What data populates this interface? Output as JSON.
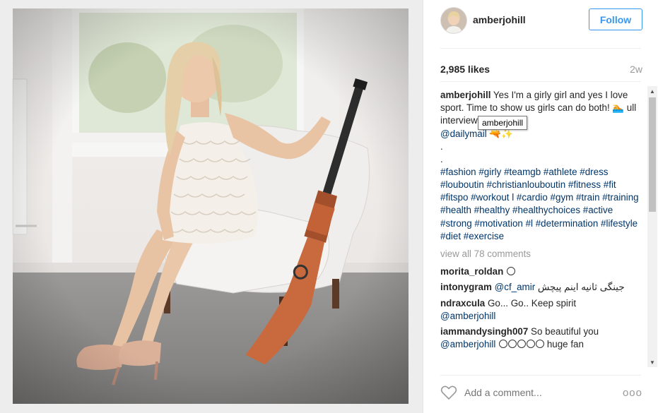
{
  "post": {
    "username": "amberjohill",
    "follow_label": "Follow",
    "likes": "2,985 likes",
    "time": "2w",
    "caption": {
      "username": "amberjohill",
      "line1": "Yes I'm a girly girl and yes I love sport. Time to show us girls can do both! 🏊",
      "line2": "ull interview in today's",
      "mention": "@dailymail",
      "dots": [
        ".",
        "."
      ],
      "hashtags": "#fashion #girly #teamgb #athlete #dress #louboutin #christianlouboutin #fitness #fit #fitspo #workout l #cardio #gym #train #training #health #healthy #healthychoices #active #strong #motivation #l #determination #lifestyle #diet #exercise"
    },
    "tooltip": "amberjohill",
    "view_all": "view all 78 comments",
    "comments": [
      {
        "user": "morita_roldan",
        "text": "",
        "emoji_count": 1
      },
      {
        "user": "intonygram",
        "mention": "@cf_amir",
        "text": "جینگی ثانیه اینم پیچش",
        "emoji_count": 0
      },
      {
        "user": "ndraxcula",
        "text": "Go... Go.. Keep spirit",
        "mention2": "@amberjohill",
        "emoji_count": 0
      },
      {
        "user": "iammandysingh007",
        "text": "So beautiful you",
        "mention2": "@amberjohill",
        "tail": "huge fan",
        "emoji_count": 5
      }
    ],
    "add_comment_placeholder": "Add a comment...",
    "more_label": "ooo"
  },
  "icons": {
    "heart": "heart-icon",
    "more": "more-options-icon",
    "avatar": "profile-avatar"
  },
  "colors": {
    "accent": "#3897f0",
    "link": "#003569",
    "muted": "#999999"
  }
}
